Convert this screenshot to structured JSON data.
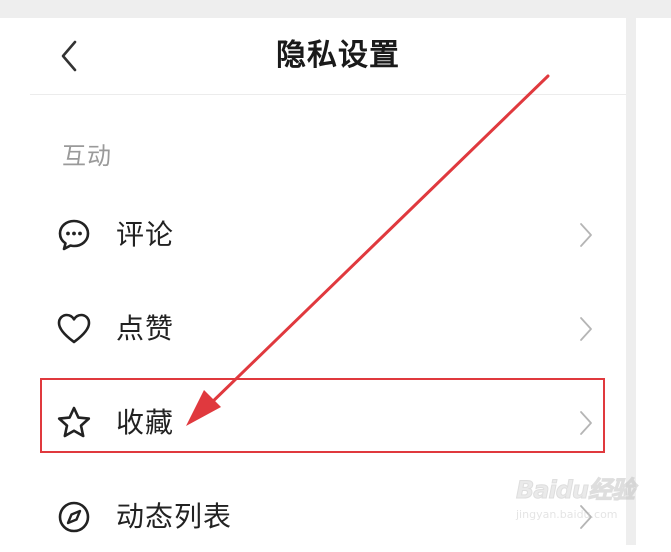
{
  "header": {
    "title": "隐私设置",
    "back_icon": "chevron-left-icon"
  },
  "section": {
    "label": "互动"
  },
  "items": [
    {
      "label": "评论",
      "icon": "comment-icon"
    },
    {
      "label": "点赞",
      "icon": "heart-icon"
    },
    {
      "label": "收藏",
      "icon": "star-icon"
    },
    {
      "label": "动态列表",
      "icon": "compass-icon"
    }
  ],
  "annotation": {
    "color": "#e0393e",
    "highlighted_item": "收藏"
  },
  "watermark": {
    "logo": "Baidu经验",
    "url": "jingyan.baidu.com"
  }
}
